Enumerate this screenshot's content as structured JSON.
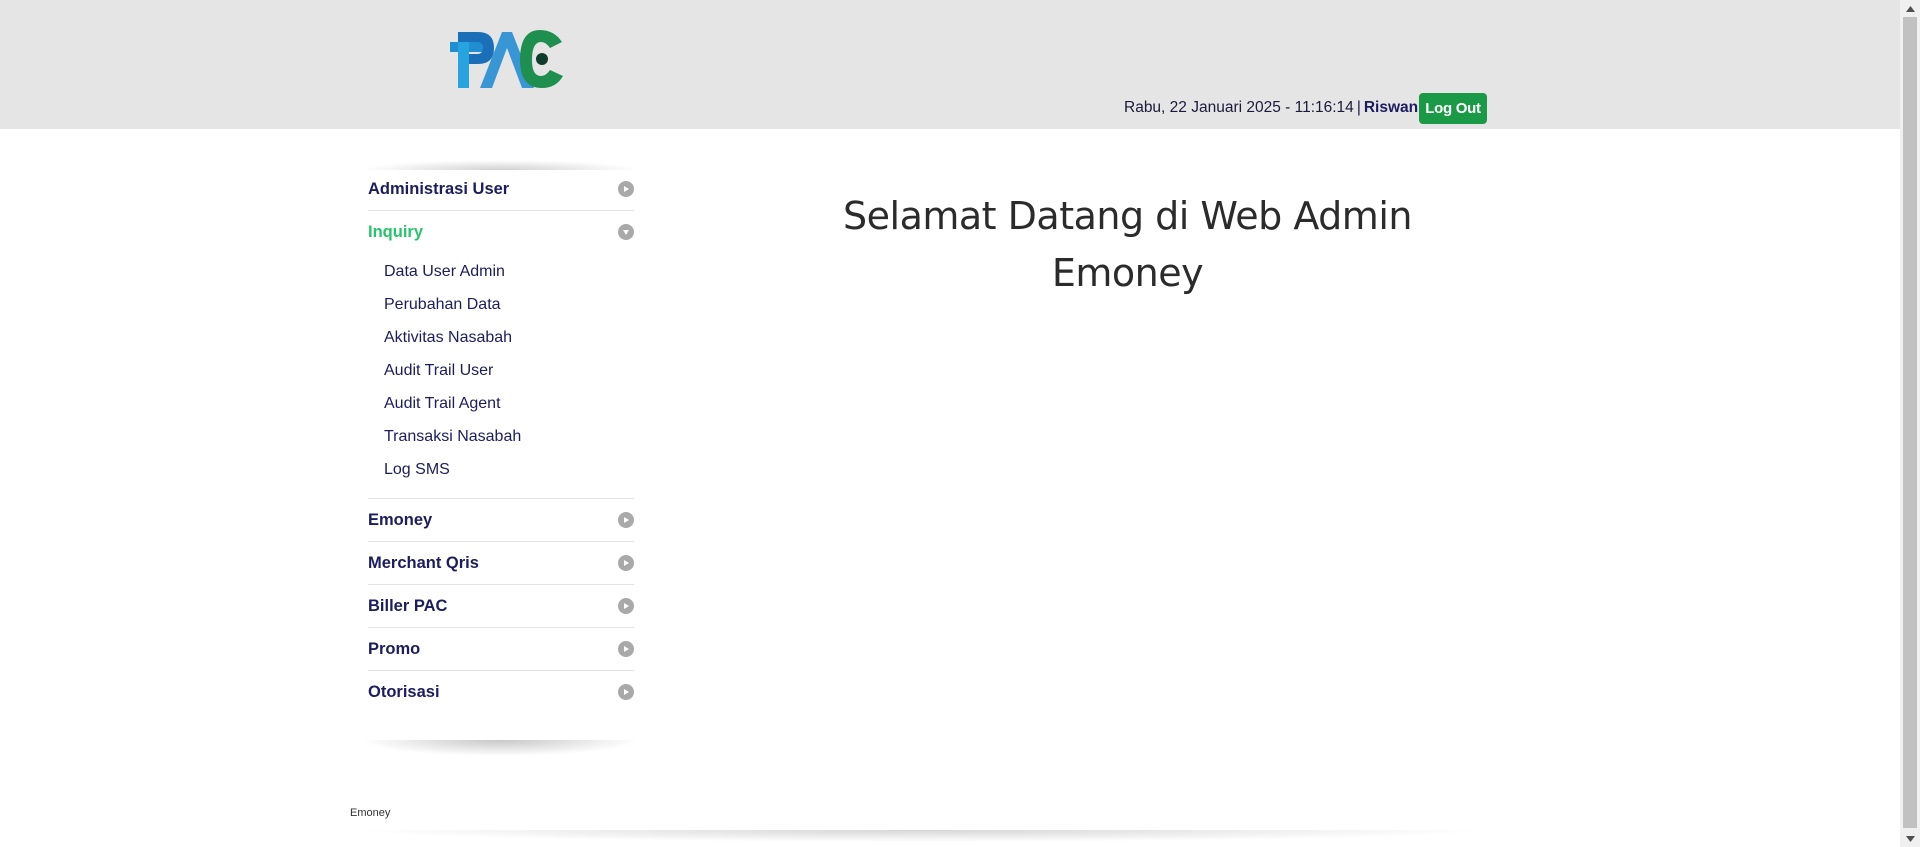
{
  "header": {
    "logo_name": "PAC",
    "datetime": "Rabu, 22 Januari 2025 - 11:16:14",
    "separator": "|",
    "username": "Riswan",
    "logout_label": "Log Out"
  },
  "sidebar": {
    "items": [
      {
        "label": "Administrasi User",
        "icon": "chevron-right-icon",
        "state": "collapsed"
      },
      {
        "label": "Inquiry",
        "icon": "chevron-down-icon",
        "state": "expanded",
        "active_color": "#27c46b",
        "children": [
          {
            "label": "Data User Admin"
          },
          {
            "label": "Perubahan Data"
          },
          {
            "label": "Aktivitas Nasabah"
          },
          {
            "label": "Audit Trail User"
          },
          {
            "label": "Audit Trail Agent"
          },
          {
            "label": "Transaksi Nasabah"
          },
          {
            "label": "Log SMS"
          }
        ]
      },
      {
        "label": "Emoney",
        "icon": "chevron-right-icon",
        "state": "collapsed"
      },
      {
        "label": "Merchant Qris",
        "icon": "chevron-right-icon",
        "state": "collapsed"
      },
      {
        "label": "Biller PAC",
        "icon": "chevron-right-icon",
        "state": "collapsed"
      },
      {
        "label": "Promo",
        "icon": "chevron-right-icon",
        "state": "collapsed"
      },
      {
        "label": "Otorisasi",
        "icon": "chevron-right-icon",
        "state": "collapsed"
      }
    ]
  },
  "main": {
    "welcome_line1": "Selamat Datang di Web Admin",
    "welcome_line2": "Emoney"
  },
  "footer": {
    "text": "Emoney"
  },
  "colors": {
    "header_bg": "#e6e5e6",
    "nav_text": "#1c1c5e",
    "active": "#27c46b",
    "logout_bg": "#1a9a47"
  }
}
